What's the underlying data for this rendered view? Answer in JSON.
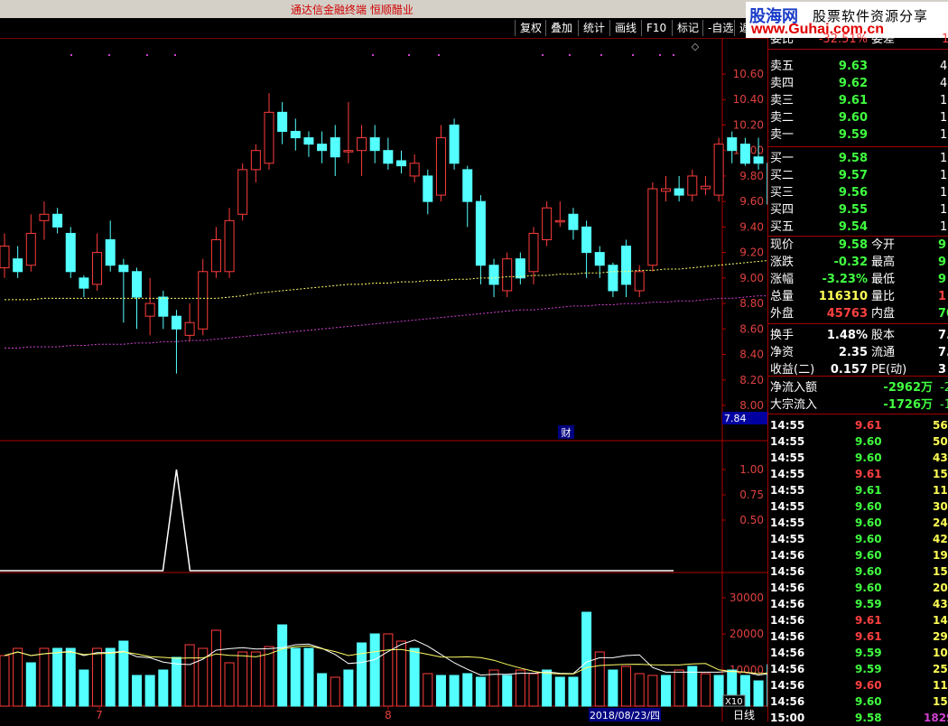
{
  "app": {
    "title": "通达信金融终端  恒顺醋业"
  },
  "logo": {
    "line1a": "股海网",
    "line1b": "股票软件资源分享",
    "line2": "www.Guhai.com.cn"
  },
  "toolbar": [
    {
      "label": "复权"
    },
    {
      "label": "叠加"
    },
    {
      "label": "统计"
    },
    {
      "label": "画线"
    },
    {
      "label": "F10"
    },
    {
      "label": "标记"
    },
    {
      "label": "-自选"
    },
    {
      "label": "返"
    }
  ],
  "chart_data": [
    {
      "type": "candlestick",
      "ylim": [
        8.0,
        10.6
      ],
      "ticks": [
        "10.60",
        "10.40",
        "10.20",
        "10.00",
        "9.80",
        "9.60",
        "9.40",
        "9.20",
        "9.00",
        "8.80",
        "8.60",
        "8.40",
        "8.20",
        "8.00"
      ],
      "candles": [
        [
          9.08,
          9.25,
          9.35,
          9.0
        ],
        [
          9.15,
          9.05,
          9.25,
          9.0
        ],
        [
          9.1,
          9.35,
          9.5,
          9.05
        ],
        [
          9.45,
          9.5,
          9.6,
          9.3
        ],
        [
          9.5,
          9.4,
          9.55,
          9.35
        ],
        [
          9.35,
          9.05,
          9.4,
          9.0
        ],
        [
          9.0,
          8.92,
          9.02,
          8.85
        ],
        [
          8.95,
          9.2,
          9.35,
          8.9
        ],
        [
          9.3,
          9.1,
          9.45,
          9.05
        ],
        [
          9.1,
          9.05,
          9.15,
          8.65
        ],
        [
          9.05,
          8.85,
          9.08,
          8.6
        ],
        [
          8.7,
          8.8,
          9.0,
          8.55
        ],
        [
          8.85,
          8.7,
          8.9,
          8.6
        ],
        [
          8.7,
          8.6,
          8.75,
          8.25
        ],
        [
          8.55,
          8.65,
          8.8,
          8.5
        ],
        [
          8.6,
          9.05,
          9.15,
          8.55
        ],
        [
          9.05,
          9.3,
          9.4,
          9.0
        ],
        [
          9.05,
          9.45,
          9.55,
          9.0
        ],
        [
          9.5,
          9.85,
          9.9,
          9.45
        ],
        [
          9.85,
          10.0,
          10.05,
          9.75
        ],
        [
          9.9,
          10.3,
          10.45,
          9.85
        ],
        [
          10.3,
          10.15,
          10.38,
          10.05
        ],
        [
          10.15,
          10.1,
          10.25,
          10.0
        ],
        [
          10.1,
          10.05,
          10.15,
          9.95
        ],
        [
          10.05,
          10.0,
          10.15,
          9.9
        ],
        [
          10.1,
          9.95,
          10.2,
          9.8
        ],
        [
          10.0,
          10.0,
          10.38,
          9.9
        ],
        [
          10.0,
          10.1,
          10.2,
          9.8
        ],
        [
          10.1,
          10.0,
          10.2,
          9.9
        ],
        [
          10.0,
          9.9,
          10.1,
          9.85
        ],
        [
          9.92,
          9.88,
          10.0,
          9.82
        ],
        [
          9.8,
          9.9,
          9.97,
          9.75
        ],
        [
          9.8,
          9.6,
          9.85,
          9.5
        ],
        [
          9.65,
          10.1,
          10.2,
          9.6
        ],
        [
          10.2,
          9.9,
          10.25,
          9.85
        ],
        [
          9.85,
          9.6,
          9.88,
          9.4
        ],
        [
          9.6,
          9.1,
          9.65,
          8.95
        ],
        [
          9.1,
          8.95,
          9.15,
          8.85
        ],
        [
          8.9,
          9.15,
          9.2,
          8.85
        ],
        [
          9.15,
          9.0,
          9.2,
          8.95
        ],
        [
          9.05,
          9.35,
          9.4,
          8.95
        ],
        [
          9.3,
          9.55,
          9.6,
          9.25
        ],
        [
          9.45,
          9.45,
          9.6,
          9.4
        ],
        [
          9.5,
          9.38,
          9.55,
          9.3
        ],
        [
          9.4,
          9.2,
          9.45,
          9.0
        ],
        [
          9.2,
          9.1,
          9.25,
          9.0
        ],
        [
          9.1,
          8.9,
          9.12,
          8.85
        ],
        [
          9.25,
          8.95,
          9.3,
          8.85
        ],
        [
          8.9,
          9.05,
          9.1,
          8.85
        ],
        [
          9.1,
          9.7,
          9.75,
          9.05
        ],
        [
          9.68,
          9.7,
          9.8,
          9.6
        ],
        [
          9.7,
          9.65,
          9.8,
          9.6
        ],
        [
          9.65,
          9.8,
          9.85,
          9.6
        ],
        [
          9.7,
          9.72,
          9.8,
          9.65
        ],
        [
          9.65,
          10.05,
          10.1,
          9.6
        ],
        [
          10.1,
          10.0,
          10.15,
          9.9
        ],
        [
          10.05,
          9.9,
          10.1,
          9.88
        ],
        [
          9.95,
          9.9,
          10.1,
          9.85
        ],
        [
          9.9,
          9.58,
          9.92,
          9.55
        ]
      ],
      "ma_yellow": [
        8.83,
        8.83,
        8.83,
        8.84,
        8.84,
        8.84,
        8.84,
        8.84,
        8.84,
        8.84,
        8.84,
        8.84,
        8.84,
        8.84,
        8.84,
        8.84,
        8.84,
        8.85,
        8.86,
        8.88,
        8.89,
        8.9,
        8.91,
        8.92,
        8.93,
        8.94,
        8.95,
        8.95,
        8.96,
        8.96,
        8.97,
        8.97,
        8.98,
        8.98,
        8.99,
        8.99,
        9.0,
        9.0,
        9.01,
        9.01,
        9.02,
        9.02,
        9.03,
        9.03,
        9.04,
        9.04,
        9.05,
        9.05,
        9.06,
        9.06,
        9.07,
        9.07,
        9.08,
        9.09,
        9.1,
        9.11,
        9.12,
        9.13,
        9.14
      ],
      "ma_magenta": [
        8.45,
        8.45,
        8.46,
        8.46,
        8.46,
        8.47,
        8.47,
        8.48,
        8.48,
        8.48,
        8.49,
        8.49,
        8.5,
        8.5,
        8.51,
        8.51,
        8.52,
        8.53,
        8.54,
        8.55,
        8.56,
        8.57,
        8.58,
        8.59,
        8.6,
        8.61,
        8.62,
        8.63,
        8.64,
        8.65,
        8.66,
        8.67,
        8.68,
        8.69,
        8.7,
        8.71,
        8.72,
        8.73,
        8.74,
        8.75,
        8.75,
        8.76,
        8.77,
        8.78,
        8.78,
        8.79,
        8.79,
        8.8,
        8.8,
        8.81,
        8.81,
        8.82,
        8.82,
        8.83,
        8.84,
        8.84,
        8.85,
        8.86,
        8.86
      ],
      "last_price_label": "7.84",
      "marker": "财"
    },
    {
      "type": "line",
      "ylim": [
        0,
        1.25
      ],
      "ticks": [
        "1.00",
        "0.75",
        "0.50"
      ],
      "values_pulse": {
        "index": 13,
        "value": 1.0
      }
    },
    {
      "type": "bar",
      "ylim": [
        0,
        36000
      ],
      "ticks": [
        "30000",
        "20000",
        "10000"
      ],
      "scale_label": "X10",
      "volumes": [
        14000,
        16000,
        12000,
        16000,
        16000,
        16000,
        10000,
        16000,
        16000,
        18000,
        8500,
        8500,
        10000,
        13500,
        17000,
        16000,
        21000,
        12000,
        15000,
        15000,
        16500,
        22500,
        16000,
        16000,
        9000,
        8000,
        10000,
        17500,
        20000,
        20000,
        18000,
        16000,
        9000,
        8500,
        8500,
        9000,
        8000,
        10000,
        8500,
        10000,
        9000,
        10000,
        8000,
        8000,
        26000,
        15000,
        10000,
        11000,
        9000,
        8500,
        8500,
        10000,
        11000,
        9000,
        8500,
        10000,
        8500,
        7000,
        11500
      ],
      "up": [
        true,
        true,
        false,
        true,
        false,
        false,
        false,
        true,
        false,
        false,
        false,
        false,
        false,
        false,
        true,
        true,
        true,
        true,
        true,
        true,
        true,
        false,
        false,
        false,
        false,
        true,
        false,
        false,
        false,
        true,
        true,
        false,
        true,
        false,
        false,
        false,
        false,
        true,
        false,
        true,
        true,
        false,
        false,
        false,
        false,
        true,
        false,
        true,
        true,
        true,
        false,
        true,
        false,
        true,
        false,
        false,
        false,
        false,
        false
      ]
    }
  ],
  "axis": {
    "dates": [
      "7",
      "8"
    ],
    "cursor_date": "2018/08/23/四",
    "period": "日线"
  },
  "quote": {
    "top_partial": {
      "label": "委比",
      "value": "-32.51%",
      "label2": "委差",
      "value2": "1"
    },
    "sell": [
      {
        "label": "卖五",
        "price": "9.63",
        "vol": "4"
      },
      {
        "label": "卖四",
        "price": "9.62",
        "vol": "4"
      },
      {
        "label": "卖三",
        "price": "9.61",
        "vol": "1"
      },
      {
        "label": "卖二",
        "price": "9.60",
        "vol": "1"
      },
      {
        "label": "卖一",
        "price": "9.59",
        "vol": "1"
      }
    ],
    "buy": [
      {
        "label": "买一",
        "price": "9.58",
        "vol": "1"
      },
      {
        "label": "买二",
        "price": "9.57",
        "vol": "1"
      },
      {
        "label": "买三",
        "price": "9.56",
        "vol": "1"
      },
      {
        "label": "买四",
        "price": "9.55",
        "vol": "1"
      },
      {
        "label": "买五",
        "price": "9.54",
        "vol": "1"
      }
    ],
    "stats": [
      {
        "l1": "现价",
        "v1": "9.58",
        "c1": "#40ff40",
        "l2": "今开",
        "v2": "9",
        "c2": "#40ff40"
      },
      {
        "l1": "涨跌",
        "v1": "-0.32",
        "c1": "#40ff40",
        "l2": "最高",
        "v2": "9",
        "c2": "#40ff40"
      },
      {
        "l1": "涨幅",
        "v1": "-3.23%",
        "c1": "#40ff40",
        "l2": "最低",
        "v2": "9",
        "c2": "#40ff40"
      },
      {
        "l1": "总量",
        "v1": "116310",
        "c1": "#ffff55",
        "l2": "量比",
        "v2": "1",
        "c2": "#ff4040"
      },
      {
        "l1": "外盘",
        "v1": "45763",
        "c1": "#ff4040",
        "l2": "内盘",
        "v2": "70",
        "c2": "#40ff40"
      },
      {
        "l1": "换手",
        "v1": "1.48%",
        "c1": "#ffffff",
        "l2": "股本",
        "v2": "7.8",
        "c2": "#ffffff"
      },
      {
        "l1": "净资",
        "v1": "2.35",
        "c1": "#ffffff",
        "l2": "流通",
        "v2": "7.8",
        "c2": "#ffffff"
      },
      {
        "l1": "收益(二)",
        "v1": "0.157",
        "c1": "#ffffff",
        "l2": "PE(动)",
        "v2": "3",
        "c2": "#ffffff"
      }
    ],
    "flows": [
      {
        "label": "净流入额",
        "value": "-2962万",
        "tail": "-2"
      },
      {
        "label": "大宗流入",
        "value": "-1726万",
        "tail": "-1"
      }
    ]
  },
  "ticks": [
    {
      "time": "14:55",
      "price": "9.61",
      "vol": "56",
      "color": "#ff4040"
    },
    {
      "time": "14:55",
      "price": "9.60",
      "vol": "50",
      "color": "#40ff40"
    },
    {
      "time": "14:55",
      "price": "9.60",
      "vol": "43",
      "color": "#40ff40"
    },
    {
      "time": "14:55",
      "price": "9.61",
      "vol": "15",
      "color": "#ff4040"
    },
    {
      "time": "14:55",
      "price": "9.61",
      "vol": "11",
      "color": "#40ff40"
    },
    {
      "time": "14:55",
      "price": "9.60",
      "vol": "30",
      "color": "#40ff40"
    },
    {
      "time": "14:55",
      "price": "9.60",
      "vol": "24",
      "color": "#40ff40"
    },
    {
      "time": "14:55",
      "price": "9.60",
      "vol": "42",
      "color": "#40ff40"
    },
    {
      "time": "14:56",
      "price": "9.60",
      "vol": "19",
      "color": "#40ff40"
    },
    {
      "time": "14:56",
      "price": "9.60",
      "vol": "15",
      "color": "#40ff40"
    },
    {
      "time": "14:56",
      "price": "9.60",
      "vol": "20",
      "color": "#40ff40"
    },
    {
      "time": "14:56",
      "price": "9.59",
      "vol": "43",
      "color": "#40ff40"
    },
    {
      "time": "14:56",
      "price": "9.61",
      "vol": "14",
      "color": "#ff4040"
    },
    {
      "time": "14:56",
      "price": "9.61",
      "vol": "29",
      "color": "#ff4040"
    },
    {
      "time": "14:56",
      "price": "9.59",
      "vol": "10",
      "color": "#40ff40"
    },
    {
      "time": "14:56",
      "price": "9.59",
      "vol": "25",
      "color": "#40ff40"
    },
    {
      "time": "14:56",
      "price": "9.60",
      "vol": "11",
      "color": "#ff4040"
    },
    {
      "time": "14:56",
      "price": "9.60",
      "vol": "15",
      "color": "#40ff40"
    },
    {
      "time": "15:00",
      "price": "9.58",
      "vol": "1829",
      "color": "#40ff40"
    }
  ]
}
